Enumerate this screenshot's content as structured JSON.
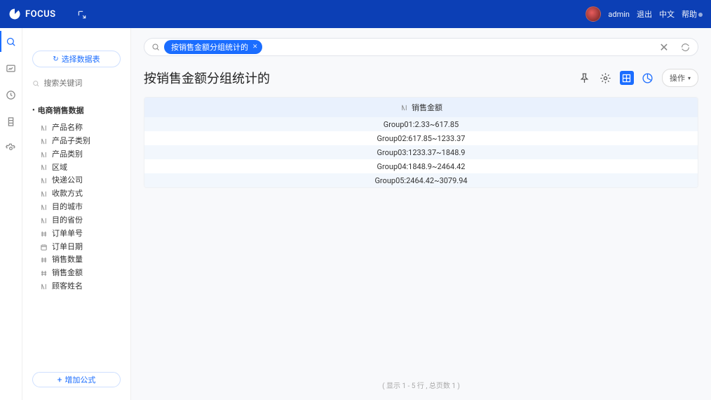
{
  "header": {
    "brand": "FOCUS",
    "user": "admin",
    "links": {
      "logout": "退出",
      "lang": "中文",
      "help": "帮助"
    }
  },
  "sidebar": {
    "select_btn": "选择数据表",
    "search_placeholder": "搜索关键词",
    "dataset": "电商销售数据",
    "fields": [
      {
        "type": "text",
        "name": "产品名称"
      },
      {
        "type": "text",
        "name": "产品子类别"
      },
      {
        "type": "text",
        "name": "产品类别"
      },
      {
        "type": "text",
        "name": "区域"
      },
      {
        "type": "text",
        "name": "快递公司"
      },
      {
        "type": "text",
        "name": "收款方式"
      },
      {
        "type": "text",
        "name": "目的城市"
      },
      {
        "type": "text",
        "name": "目的省份"
      },
      {
        "type": "num",
        "name": "订单单号"
      },
      {
        "type": "date",
        "name": "订单日期"
      },
      {
        "type": "num",
        "name": "销售数量"
      },
      {
        "type": "num",
        "name": "销售金额"
      },
      {
        "type": "text",
        "name": "顾客姓名"
      }
    ],
    "add_formula": "增加公式"
  },
  "searchbar": {
    "pill": "按销售金额分组统计的"
  },
  "title": "按销售金额分组统计的",
  "toolbar": {
    "ops": "操作"
  },
  "table": {
    "header": "销售金额",
    "rows": [
      "Group01:2.33~617.85",
      "Group02:617.85~1233.37",
      "Group03:1233.37~1848.9",
      "Group04:1848.9~2464.42",
      "Group05:2464.42~3079.94"
    ]
  },
  "footer": "( 显示 1 - 5 行 , 总页数 1 )"
}
